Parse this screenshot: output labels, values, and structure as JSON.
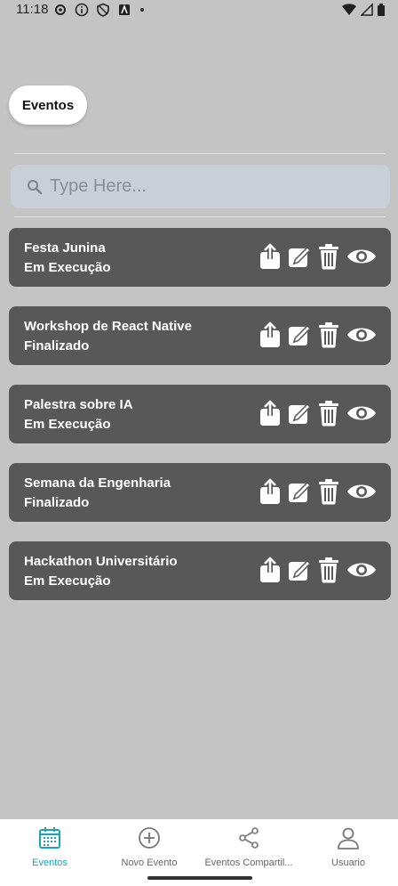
{
  "status_bar": {
    "time": "11:18"
  },
  "header": {
    "title": "Eventos"
  },
  "search": {
    "placeholder": "Type Here..."
  },
  "events": [
    {
      "name": "Festa Junina",
      "status": "Em Execução"
    },
    {
      "name": "Workshop de React Native",
      "status": "Finalizado"
    },
    {
      "name": "Palestra sobre IA",
      "status": "Em Execução"
    },
    {
      "name": "Semana da Engenharia",
      "status": "Finalizado"
    },
    {
      "name": "Hackathon Universitário",
      "status": "Em Execução"
    }
  ],
  "bottom_nav": {
    "items": [
      {
        "label": "Eventos",
        "icon": "calendar-icon",
        "active": true
      },
      {
        "label": "Novo Evento",
        "icon": "plus-circle-icon",
        "active": false
      },
      {
        "label": "Eventos Compartil...",
        "icon": "share-icon",
        "active": false
      },
      {
        "label": "Usuario",
        "icon": "user-icon",
        "active": false
      }
    ]
  },
  "colors": {
    "accent": "#1ba3b5",
    "card": "#585858",
    "background": "#c4c4c4"
  }
}
